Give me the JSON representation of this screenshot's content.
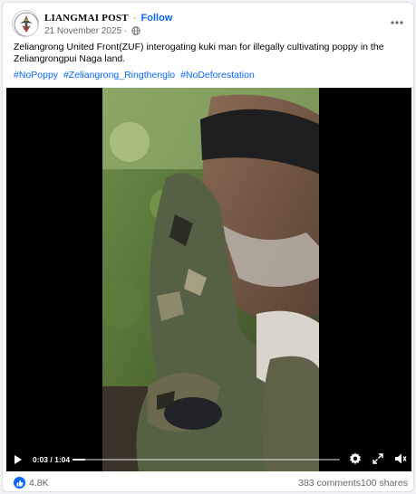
{
  "header": {
    "page_name": "LIANGMAI POST",
    "separator": "·",
    "follow_label": "Follow",
    "date": "21 November 2025",
    "meta_separator": "·",
    "privacy_icon": "globe-icon",
    "more_icon": "more-options-icon"
  },
  "post": {
    "caption": "Zeliangrong United Front(ZUF) interogating kuki man for illegally cultivating poppy in the Zeliangrongpui Naga land.",
    "hashtags": [
      "#NoPoppy",
      "#Zeliangrong_Ringthenglo",
      "#NoDeforestation"
    ]
  },
  "video": {
    "time_display": "0:03 / 1:04",
    "progress": 0.047,
    "play_icon": "play-icon",
    "settings_icon": "gear-icon",
    "fullscreen_icon": "expand-icon",
    "volume_icon": "volume-icon"
  },
  "footer": {
    "reaction_icon": "like-icon",
    "reaction_count": "4.8K",
    "comments": "383 comments",
    "shares": "100 shares"
  },
  "colors": {
    "accent": "#0866ff",
    "secondary_text": "#65676b",
    "background": "#f0f2f5"
  }
}
